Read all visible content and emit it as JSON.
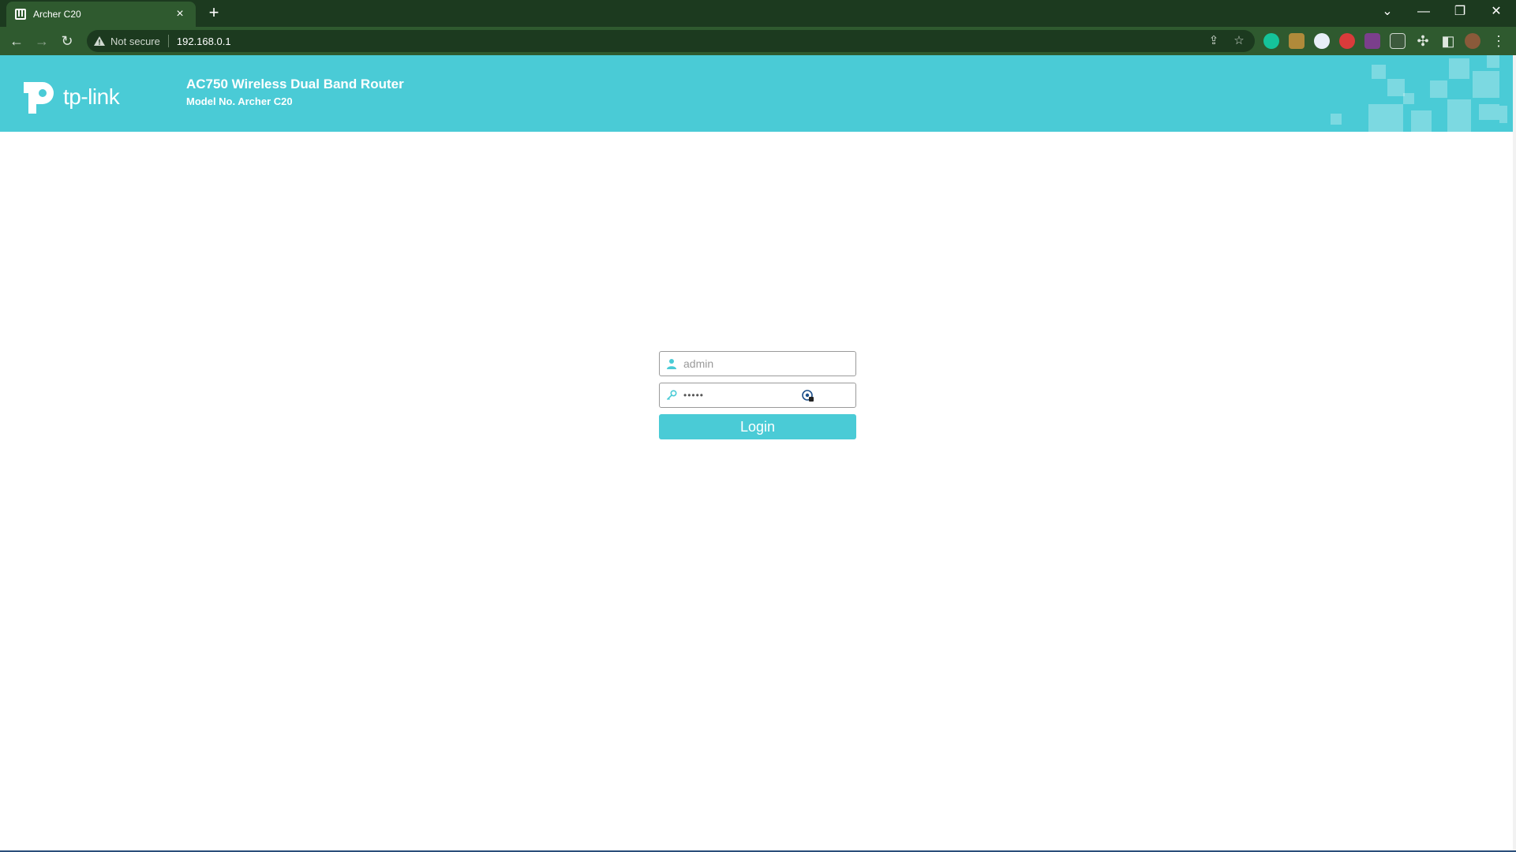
{
  "browser": {
    "tab_title": "Archer C20",
    "new_tab": "+",
    "not_secure": "Not secure",
    "url": "192.168.0.1",
    "controls": {
      "minimize": "—",
      "restore": "❐",
      "close": "✕",
      "tab_search": "⌄"
    }
  },
  "header": {
    "logo_text": "tp-link",
    "product_name": "AC750 Wireless Dual Band Router",
    "model": "Model No. Archer C20"
  },
  "login": {
    "username_value": "admin",
    "password_mask": "•••••",
    "button_label": "Login"
  },
  "colors": {
    "brand": "#4acbd6",
    "chrome_dark": "#1c3a1f",
    "chrome_light": "#2f5a2f"
  }
}
